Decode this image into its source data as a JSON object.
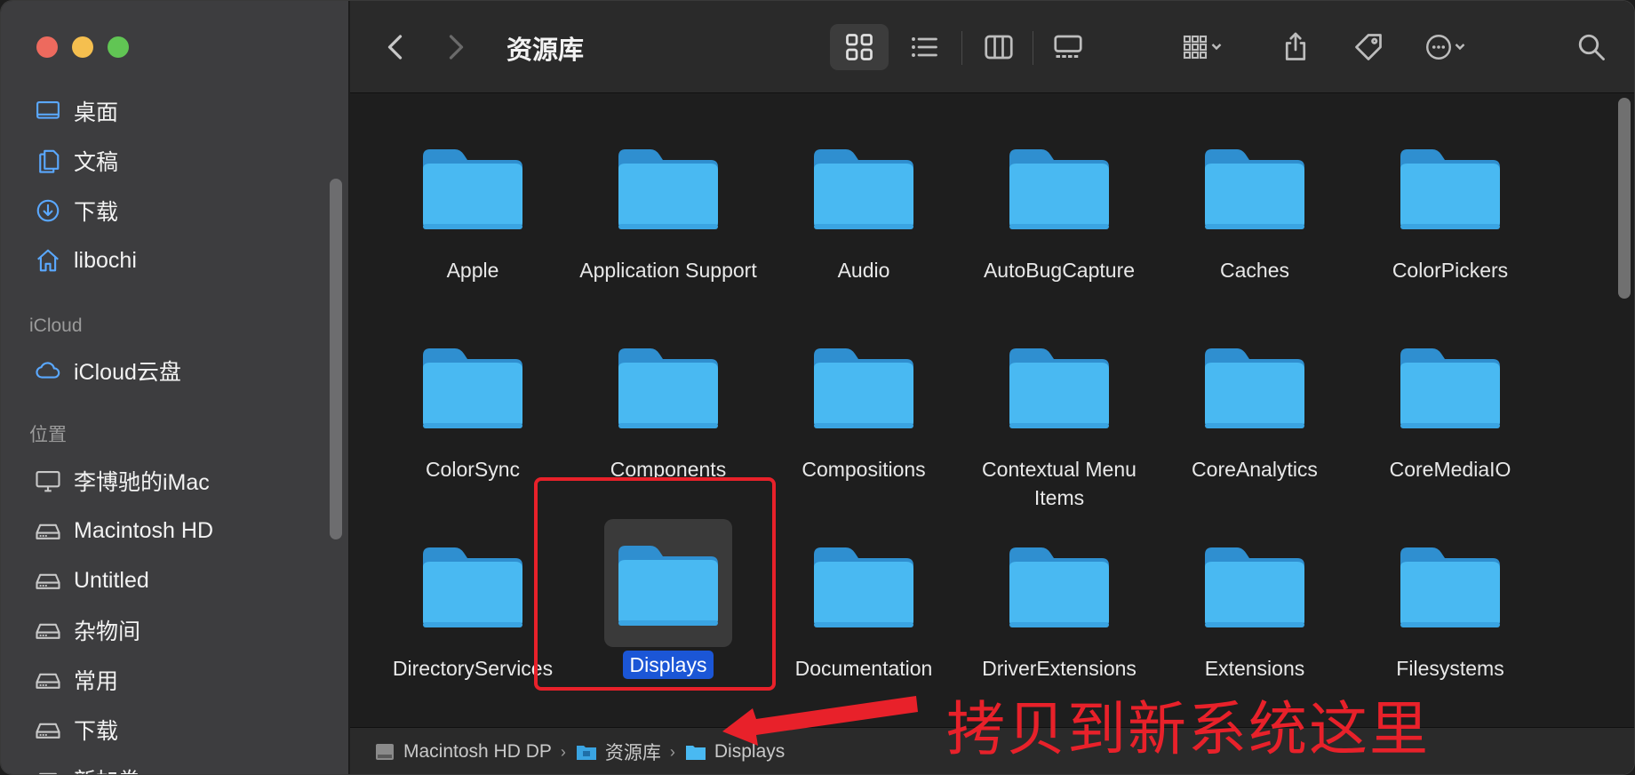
{
  "toolbar": {
    "title": "资源库"
  },
  "sidebar": {
    "favorites": [
      {
        "label": "桌面",
        "icon": "desktop-icon"
      },
      {
        "label": "文稿",
        "icon": "document-icon"
      },
      {
        "label": "下载",
        "icon": "download-icon"
      },
      {
        "label": "libochi",
        "icon": "home-icon"
      }
    ],
    "icloud_header": "iCloud",
    "icloud": [
      {
        "label": "iCloud云盘",
        "icon": "cloud-icon"
      }
    ],
    "locations_header": "位置",
    "locations": [
      {
        "label": "李博驰的iMac",
        "icon": "computer-icon"
      },
      {
        "label": "Macintosh HD",
        "icon": "drive-icon"
      },
      {
        "label": "Untitled",
        "icon": "drive-icon"
      },
      {
        "label": "杂物间",
        "icon": "drive-icon"
      },
      {
        "label": "常用",
        "icon": "drive-icon"
      },
      {
        "label": "下载",
        "icon": "drive-icon"
      },
      {
        "label": "新加卷",
        "icon": "drive-icon"
      }
    ]
  },
  "folders": [
    "Apple",
    "Application Support",
    "Audio",
    "AutoBugCapture",
    "Caches",
    "ColorPickers",
    "ColorSync",
    "Components",
    "Compositions",
    "Contextual Menu Items",
    "CoreAnalytics",
    "CoreMediaIO",
    "DirectoryServices",
    "Displays",
    "Documentation",
    "DriverExtensions",
    "Extensions",
    "Filesystems"
  ],
  "selected_folder": "Displays",
  "annotation": {
    "text": "拷贝到新系统这里",
    "color": "#e8212a"
  },
  "pathbar": {
    "items": [
      "Macintosh HD DP",
      "资源库",
      "Displays"
    ]
  },
  "colors": {
    "folder": "#49b9f2",
    "selection": "#1b56d6"
  }
}
